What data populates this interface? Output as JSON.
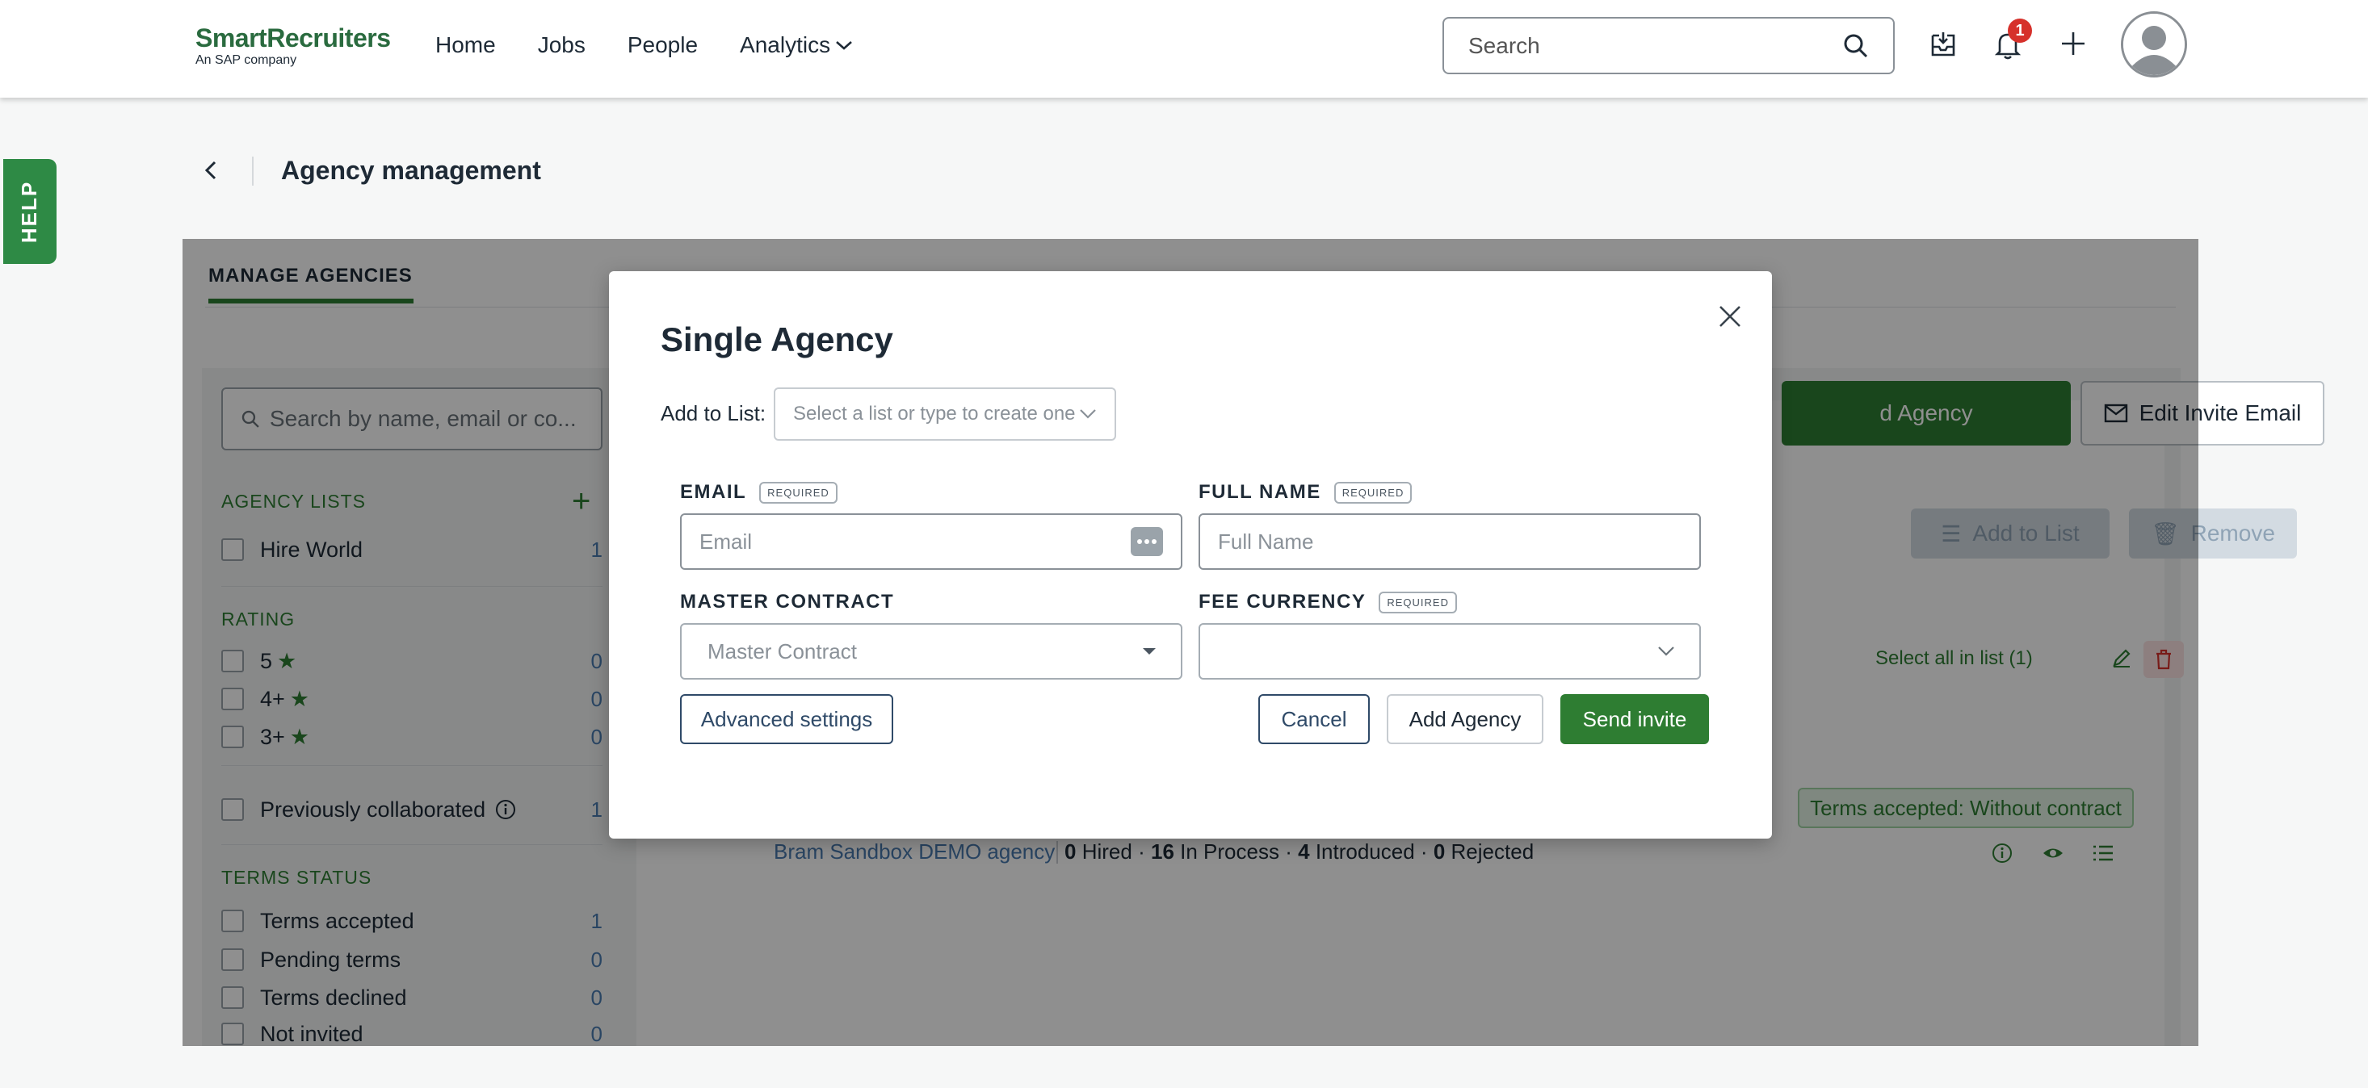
{
  "header": {
    "logo_main": "SmartRecruiters",
    "logo_sub": "An SAP company",
    "nav": [
      {
        "label": "Home"
      },
      {
        "label": "Jobs"
      },
      {
        "label": "People"
      },
      {
        "label": "Analytics"
      }
    ],
    "search_placeholder": "Search",
    "notification_count": "1"
  },
  "help_label": "HELP",
  "page": {
    "title": "Agency management",
    "tab_label": "MANAGE AGENCIES"
  },
  "sidebar": {
    "search_placeholder": "Search by name, email or co...",
    "agency_lists_heading": "AGENCY LISTS",
    "agency_lists": [
      {
        "label": "Hire World",
        "count": "1"
      }
    ],
    "rating_heading": "RATING",
    "ratings": [
      {
        "label": "5",
        "count": "0"
      },
      {
        "label": "4+",
        "count": "0"
      },
      {
        "label": "3+",
        "count": "0"
      }
    ],
    "prev_collab": {
      "label": "Previously collaborated",
      "count": "1"
    },
    "terms_heading": "TERMS STATUS",
    "terms": [
      {
        "label": "Terms accepted",
        "count": "1"
      },
      {
        "label": "Pending terms",
        "count": "0"
      },
      {
        "label": "Terms declined",
        "count": "0"
      },
      {
        "label": "Not invited",
        "count": "0"
      }
    ]
  },
  "toolbar": {
    "add_agency_label": "d Agency",
    "edit_invite_label": "Edit Invite Email",
    "add_to_list_label": "Add to List",
    "remove_label": "Remove",
    "select_all_label": "Select all in list (1)"
  },
  "agency_row": {
    "terms_badge": "Terms accepted: Without contract",
    "name": "Bram Sandbox DEMO agency",
    "hired": "0",
    "hired_label": "Hired",
    "in_process": "16",
    "in_process_label": "In Process",
    "introduced": "4",
    "introduced_label": "Introduced",
    "rejected": "0",
    "rejected_label": "Rejected",
    "sep": "·"
  },
  "modal": {
    "title": "Single Agency",
    "add_to_list_label": "Add to List:",
    "list_placeholder": "Select a list or type to create one",
    "email_label": "EMAIL",
    "email_placeholder": "Email",
    "fullname_label": "FULL NAME",
    "fullname_placeholder": "Full Name",
    "required_tag": "REQUIRED",
    "master_contract_label": "MASTER CONTRACT",
    "master_contract_placeholder": "Master Contract",
    "fee_currency_label": "FEE CURRENCY",
    "fee_currency_value": "",
    "advanced_settings": "Advanced settings",
    "cancel": "Cancel",
    "add_agency": "Add Agency",
    "send_invite": "Send invite"
  },
  "colors": {
    "brand_green": "#2e7d32",
    "link_blue": "#4a7bb0",
    "navy": "#2f4a68",
    "badge_red": "#d6312b"
  },
  "icons": {
    "search": "search-icon",
    "inbox": "inbox-icon",
    "bell": "bell-icon",
    "plus": "plus-icon",
    "avatar": "user-avatar-icon",
    "close": "close-icon",
    "chevron": "chevron-down-icon"
  }
}
